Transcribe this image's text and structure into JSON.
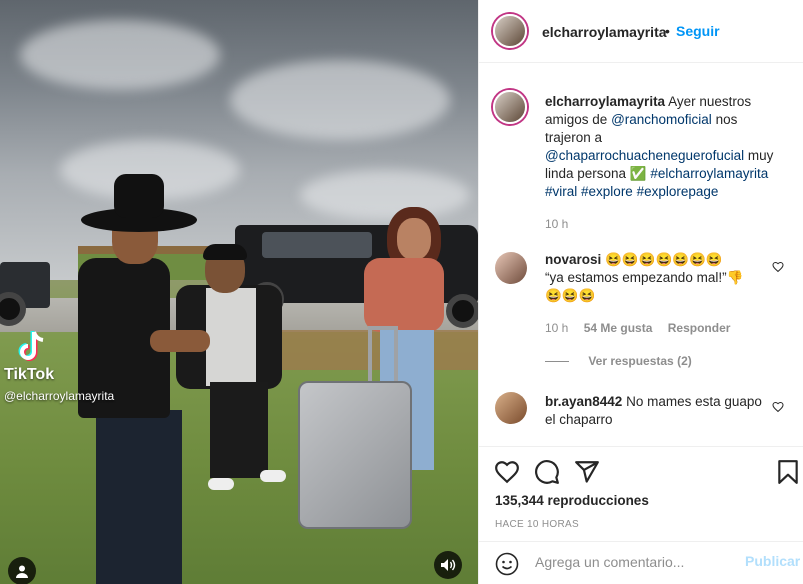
{
  "media": {
    "watermark": {
      "brand": "TikTok",
      "handle": "@elcharroylamayrita"
    }
  },
  "header": {
    "username": "elcharroylamayrita",
    "separator": "•",
    "follow_label": "Seguir",
    "more_label": "···"
  },
  "caption": {
    "username": "elcharroylamayrita",
    "part1": "Ayer nuestros amigos de",
    "mention1": "@ranchomoficial",
    "part2": "nos trajeron a",
    "mention2": "@chaparrochuacheneguerofucial",
    "part3": "muy linda persona",
    "check_emoji": "✅",
    "hashtags": [
      "#elcharroylamayrita",
      "#viral",
      "#explore",
      "#explorepage"
    ],
    "time": "10 h"
  },
  "comments": [
    {
      "username": "novarosi",
      "text_line1": "😆😆😆😆😆😆😆",
      "text_line2": "“ya estamos empezando mal!”👎",
      "text_line3": "😆😆😆",
      "time": "10 h",
      "likes": "54 Me gusta",
      "reply": "Responder",
      "view_replies": "Ver respuestas (2)"
    },
    {
      "username": "br.ayan8442",
      "text": "No mames esta guapo el chaparro"
    }
  ],
  "stats": {
    "views": "135,344 reproducciones",
    "time_ago": "HACE 10 HORAS"
  },
  "comment_box": {
    "placeholder": "Agrega un comentario...",
    "post_label": "Publicar"
  },
  "colors": {
    "accent": "#0095f6",
    "link": "#00376b",
    "muted": "#8e8e8e",
    "post_disabled": "#b2dffc"
  }
}
